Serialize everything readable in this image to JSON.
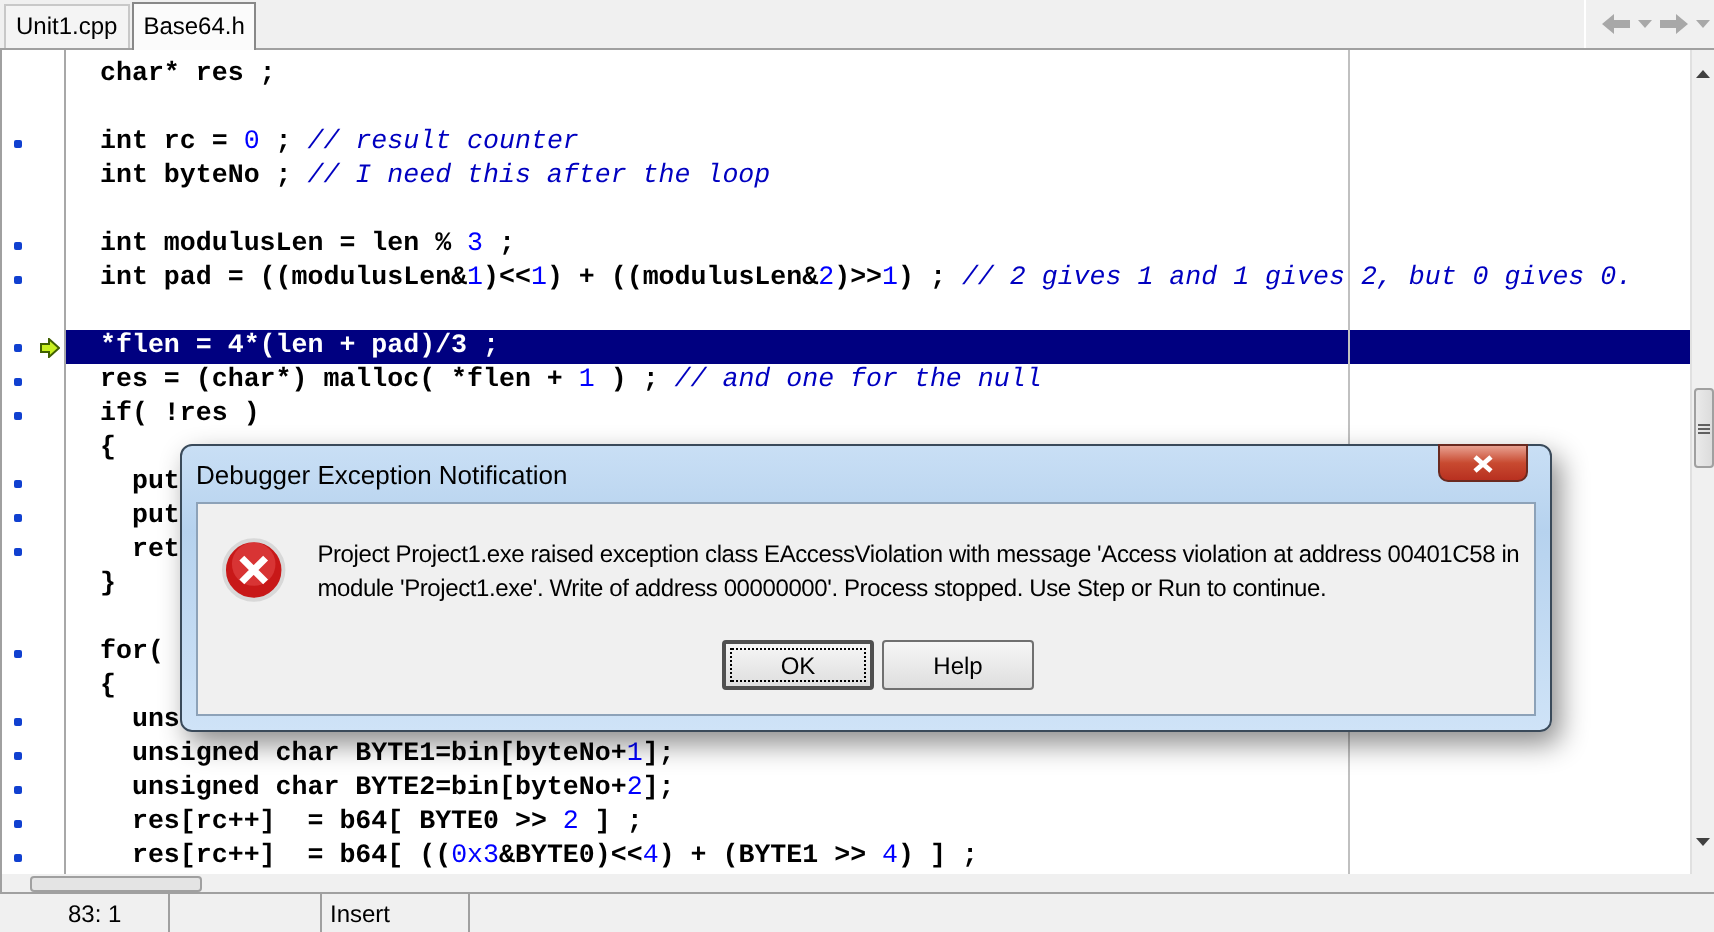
{
  "tabs": [
    {
      "label": "Unit1.cpp",
      "selected": false
    },
    {
      "label": "Base64.h",
      "selected": true
    }
  ],
  "nav": [
    {
      "kind": "back"
    },
    {
      "kind": "dropdown"
    },
    {
      "kind": "forward"
    },
    {
      "kind": "dropdown"
    }
  ],
  "lines": [
    {
      "marker": false,
      "current": false,
      "segments": [
        {
          "kind": "plain",
          "text": "char* res ;"
        }
      ]
    },
    {
      "marker": false,
      "current": false
    },
    {
      "marker": true,
      "current": false,
      "segments": [
        {
          "kind": "plain",
          "text": "int rc = "
        },
        {
          "kind": "number",
          "text": "0"
        },
        {
          "kind": "plain",
          "text": " ; "
        },
        {
          "kind": "comment",
          "text": "// result counter"
        }
      ]
    },
    {
      "marker": false,
      "current": false,
      "segments": [
        {
          "kind": "plain",
          "text": "int byteNo ; "
        },
        {
          "kind": "comment",
          "text": "// I need this after the loop"
        }
      ]
    },
    {
      "marker": false,
      "current": false
    },
    {
      "marker": true,
      "current": false,
      "segments": [
        {
          "kind": "plain",
          "text": "int modulusLen = len % "
        },
        {
          "kind": "number",
          "text": "3"
        },
        {
          "kind": "plain",
          "text": " ;"
        }
      ]
    },
    {
      "marker": true,
      "current": false,
      "segments": [
        {
          "kind": "plain",
          "text": "int pad = ((modulusLen&"
        },
        {
          "kind": "number",
          "text": "1"
        },
        {
          "kind": "plain",
          "text": ")<<"
        },
        {
          "kind": "number",
          "text": "1"
        },
        {
          "kind": "plain",
          "text": ") + ((modulusLen&"
        },
        {
          "kind": "number",
          "text": "2"
        },
        {
          "kind": "plain",
          "text": ")>>"
        },
        {
          "kind": "number",
          "text": "1"
        },
        {
          "kind": "plain",
          "text": ") ; "
        },
        {
          "kind": "comment",
          "text": "// 2 gives 1 and 1 gives 2, but 0 gives 0."
        }
      ]
    },
    {
      "marker": false,
      "current": false
    },
    {
      "marker": true,
      "current": true,
      "segments": [
        {
          "kind": "plain",
          "text": "*flen = 4*(len + pad)/3 ;"
        }
      ]
    },
    {
      "marker": true,
      "current": false,
      "segments": [
        {
          "kind": "plain",
          "text": "res = (char*) malloc( *flen + "
        },
        {
          "kind": "number",
          "text": "1"
        },
        {
          "kind": "plain",
          "text": " ) ; "
        },
        {
          "kind": "comment",
          "text": "// and one for the null"
        }
      ]
    },
    {
      "marker": true,
      "current": false,
      "segments": [
        {
          "kind": "plain",
          "text": "if( !res )"
        }
      ]
    },
    {
      "marker": false,
      "current": false,
      "segments": [
        {
          "kind": "plain",
          "text": "{"
        }
      ]
    },
    {
      "marker": true,
      "current": false,
      "segments": [
        {
          "kind": "plain",
          "text": "  put"
        }
      ]
    },
    {
      "marker": true,
      "current": false,
      "segments": [
        {
          "kind": "plain",
          "text": "  put"
        }
      ]
    },
    {
      "marker": true,
      "current": false,
      "segments": [
        {
          "kind": "plain",
          "text": "  ret"
        }
      ]
    },
    {
      "marker": false,
      "current": false,
      "segments": [
        {
          "kind": "plain",
          "text": "}"
        }
      ]
    },
    {
      "marker": false,
      "current": false
    },
    {
      "marker": true,
      "current": false,
      "segments": [
        {
          "kind": "plain",
          "text": "for("
        }
      ]
    },
    {
      "marker": false,
      "current": false,
      "segments": [
        {
          "kind": "plain",
          "text": "{"
        }
      ]
    },
    {
      "marker": true,
      "current": false,
      "segments": [
        {
          "kind": "plain",
          "text": "  uns"
        }
      ]
    },
    {
      "marker": true,
      "current": false,
      "segments": [
        {
          "kind": "plain",
          "text": "  unsigned char BYTE1=bin[byteNo+"
        },
        {
          "kind": "number",
          "text": "1"
        },
        {
          "kind": "plain",
          "text": "];"
        }
      ]
    },
    {
      "marker": true,
      "current": false,
      "segments": [
        {
          "kind": "plain",
          "text": "  unsigned char BYTE2=bin[byteNo+"
        },
        {
          "kind": "number",
          "text": "2"
        },
        {
          "kind": "plain",
          "text": "];"
        }
      ]
    },
    {
      "marker": true,
      "current": false,
      "segments": [
        {
          "kind": "plain",
          "text": "  res[rc++]  = b64[ BYTE0 >> "
        },
        {
          "kind": "number",
          "text": "2"
        },
        {
          "kind": "plain",
          "text": " ] ;"
        }
      ]
    },
    {
      "marker": true,
      "current": false,
      "segments": [
        {
          "kind": "plain",
          "text": "  res[rc++]  = b64[ (("
        },
        {
          "kind": "number",
          "text": "0x3"
        },
        {
          "kind": "plain",
          "text": "&BYTE0)<<"
        },
        {
          "kind": "number",
          "text": "4"
        },
        {
          "kind": "plain",
          "text": ") + (BYTE1 >> "
        },
        {
          "kind": "number",
          "text": "4"
        },
        {
          "kind": "plain",
          "text": ") ] ;"
        }
      ]
    }
  ],
  "status_bar": {
    "position": "83: 1",
    "mode": "Insert"
  },
  "dialog": {
    "title": "Debugger Exception Notification",
    "message": "Project Project1.exe raised exception class EAccessViolation with message 'Access violation at address 00401C58 in module 'Project1.exe'. Write of address 00000000'. Process stopped. Use Step or Run to continue.",
    "buttons": [
      {
        "label": "OK",
        "default": true
      },
      {
        "label": "Help",
        "default": false
      }
    ]
  }
}
